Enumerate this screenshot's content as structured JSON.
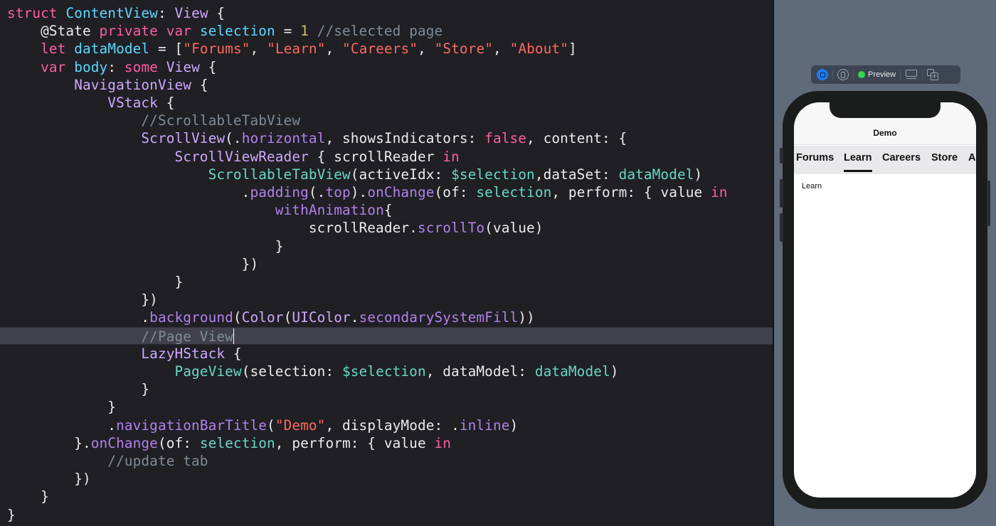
{
  "editor": {
    "current_line_index": 18,
    "lines": [
      [
        [
          "kw",
          "struct"
        ],
        [
          "plain",
          " "
        ],
        [
          "type-decl",
          "ContentView"
        ],
        [
          "plain",
          ": "
        ],
        [
          "type",
          "View"
        ],
        [
          "plain",
          " {"
        ]
      ],
      [
        [
          "plain",
          "    @State "
        ],
        [
          "kw",
          "private"
        ],
        [
          "plain",
          " "
        ],
        [
          "kw",
          "var"
        ],
        [
          "plain",
          " "
        ],
        [
          "type-decl",
          "selection"
        ],
        [
          "plain",
          " = "
        ],
        [
          "num",
          "1"
        ],
        [
          "plain",
          " "
        ],
        [
          "comment",
          "//selected page"
        ]
      ],
      [
        [
          "plain",
          "    "
        ],
        [
          "kw",
          "let"
        ],
        [
          "plain",
          " "
        ],
        [
          "type-decl",
          "dataModel"
        ],
        [
          "plain",
          " = ["
        ],
        [
          "str",
          "\"Forums\""
        ],
        [
          "plain",
          ", "
        ],
        [
          "str",
          "\"Learn\""
        ],
        [
          "plain",
          ", "
        ],
        [
          "str",
          "\"Careers\""
        ],
        [
          "plain",
          ", "
        ],
        [
          "str",
          "\"Store\""
        ],
        [
          "plain",
          ", "
        ],
        [
          "str",
          "\"About\""
        ],
        [
          "plain",
          "]"
        ]
      ],
      [
        [
          "plain",
          "    "
        ],
        [
          "kw",
          "var"
        ],
        [
          "plain",
          " "
        ],
        [
          "type-decl",
          "body"
        ],
        [
          "plain",
          ": "
        ],
        [
          "kw",
          "some"
        ],
        [
          "plain",
          " "
        ],
        [
          "type",
          "View"
        ],
        [
          "plain",
          " {"
        ]
      ],
      [
        [
          "plain",
          "        "
        ],
        [
          "type",
          "NavigationView"
        ],
        [
          "plain",
          " {"
        ]
      ],
      [
        [
          "plain",
          "            "
        ],
        [
          "type",
          "VStack"
        ],
        [
          "plain",
          " {"
        ]
      ],
      [
        [
          "plain",
          "                "
        ],
        [
          "comment",
          "//ScrollableTabView"
        ]
      ],
      [
        [
          "plain",
          "                "
        ],
        [
          "type",
          "ScrollView"
        ],
        [
          "plain",
          "(."
        ],
        [
          "method",
          "horizontal"
        ],
        [
          "plain",
          ", showsIndicators: "
        ],
        [
          "kw",
          "false"
        ],
        [
          "plain",
          ", content: {"
        ]
      ],
      [
        [
          "plain",
          "                    "
        ],
        [
          "type",
          "ScrollViewReader"
        ],
        [
          "plain",
          " { scrollReader "
        ],
        [
          "kw",
          "in"
        ]
      ],
      [
        [
          "plain",
          "                        "
        ],
        [
          "ident",
          "ScrollableTabView"
        ],
        [
          "plain",
          "(activeIdx: "
        ],
        [
          "ident",
          "$selection"
        ],
        [
          "plain",
          ",dataSet: "
        ],
        [
          "ident",
          "dataModel"
        ],
        [
          "plain",
          ")"
        ]
      ],
      [
        [
          "plain",
          "                            ."
        ],
        [
          "method",
          "padding"
        ],
        [
          "plain",
          "(."
        ],
        [
          "method",
          "top"
        ],
        [
          "plain",
          ")."
        ],
        [
          "method",
          "onChange"
        ],
        [
          "plain",
          "(of: "
        ],
        [
          "ident",
          "selection"
        ],
        [
          "plain",
          ", perform: { value "
        ],
        [
          "kw",
          "in"
        ]
      ],
      [
        [
          "plain",
          "                                "
        ],
        [
          "method",
          "withAnimation"
        ],
        [
          "plain",
          "{"
        ]
      ],
      [
        [
          "plain",
          "                                    scrollReader."
        ],
        [
          "method",
          "scrollTo"
        ],
        [
          "plain",
          "(value)"
        ]
      ],
      [
        [
          "plain",
          "                                }"
        ]
      ],
      [
        [
          "plain",
          "                            })"
        ]
      ],
      [
        [
          "plain",
          "                    }"
        ]
      ],
      [
        [
          "plain",
          "                })"
        ]
      ],
      [
        [
          "plain",
          "                ."
        ],
        [
          "method",
          "background"
        ],
        [
          "plain",
          "("
        ],
        [
          "type",
          "Color"
        ],
        [
          "plain",
          "("
        ],
        [
          "type",
          "UIColor"
        ],
        [
          "plain",
          "."
        ],
        [
          "method",
          "secondarySystemFill"
        ],
        [
          "plain",
          "))"
        ]
      ],
      [
        [
          "plain",
          "                "
        ],
        [
          "comment",
          "//Page View"
        ]
      ],
      [
        [
          "plain",
          "                "
        ],
        [
          "type",
          "LazyHStack"
        ],
        [
          "plain",
          " {"
        ]
      ],
      [
        [
          "plain",
          "                    "
        ],
        [
          "ident",
          "PageView"
        ],
        [
          "plain",
          "(selection: "
        ],
        [
          "ident",
          "$selection"
        ],
        [
          "plain",
          ", dataModel: "
        ],
        [
          "ident",
          "dataModel"
        ],
        [
          "plain",
          ")"
        ]
      ],
      [
        [
          "plain",
          "                }"
        ]
      ],
      [
        [
          "plain",
          "            }"
        ]
      ],
      [
        [
          "plain",
          "            ."
        ],
        [
          "method",
          "navigationBarTitle"
        ],
        [
          "plain",
          "("
        ],
        [
          "str",
          "\"Demo\""
        ],
        [
          "plain",
          ", displayMode: ."
        ],
        [
          "method",
          "inline"
        ],
        [
          "plain",
          ")"
        ]
      ],
      [
        [
          "plain",
          "        }."
        ],
        [
          "method",
          "onChange"
        ],
        [
          "plain",
          "(of: "
        ],
        [
          "ident",
          "selection"
        ],
        [
          "plain",
          ", perform: { value "
        ],
        [
          "kw",
          "in"
        ]
      ],
      [
        [
          "plain",
          "            "
        ],
        [
          "comment",
          "//update tab"
        ]
      ],
      [
        [
          "plain",
          "        })"
        ]
      ],
      [
        [
          "plain",
          "    }"
        ]
      ],
      [
        [
          "plain",
          "}"
        ]
      ]
    ]
  },
  "preview": {
    "toolbar": {
      "live_icon": "live-preview-icon",
      "device_icon": "device-settings-icon",
      "status_label": "Preview",
      "status_color": "#32d74b",
      "monitor_icon": "preview-on-device-icon",
      "duplicate_icon": "duplicate-preview-icon"
    },
    "app": {
      "nav_title": "Demo",
      "tabs": [
        "Forums",
        "Learn",
        "Careers",
        "Store",
        "About"
      ],
      "active_tab_index": 1,
      "page_text": "Learn"
    }
  },
  "colors": {
    "editor_bg": "#1f1f24",
    "keyword": "#fc5fa3",
    "string": "#fc6a5d",
    "comment": "#7f8c98",
    "canvas_bg": "#5f6a7a"
  }
}
